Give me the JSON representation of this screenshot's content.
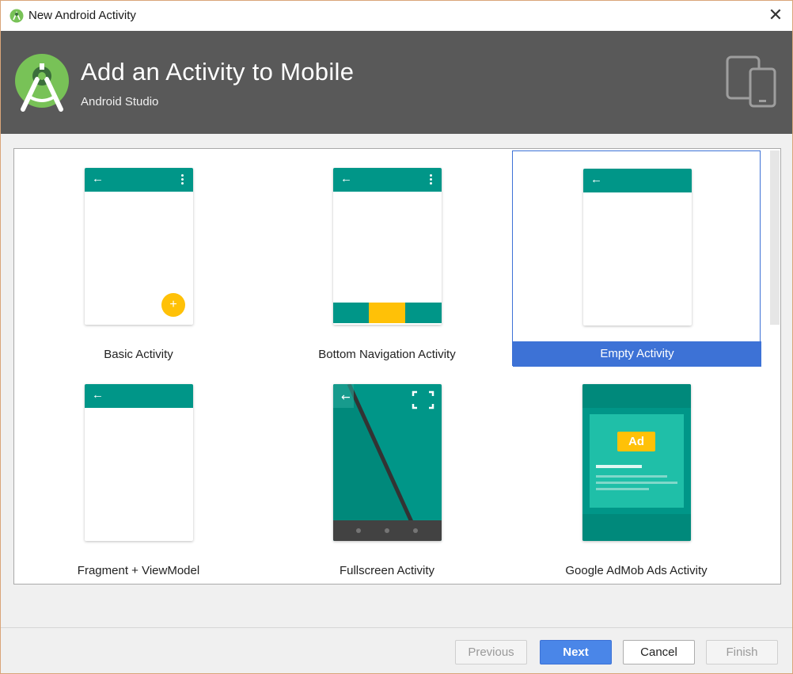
{
  "window": {
    "title": "New Android Activity",
    "close_glyph": "✕"
  },
  "header": {
    "title": "Add an Activity to Mobile",
    "subtitle": "Android Studio"
  },
  "gallery": {
    "selected": "Empty Activity",
    "tiles": [
      {
        "label": "Basic Activity",
        "preview": "basic"
      },
      {
        "label": "Bottom Navigation Activity",
        "preview": "bottom-navigation"
      },
      {
        "label": "Empty Activity",
        "preview": "empty"
      },
      {
        "label": "Fragment + ViewModel",
        "preview": "fragment-viewmodel"
      },
      {
        "label": "Fullscreen Activity",
        "preview": "fullscreen"
      },
      {
        "label": "Google AdMob Ads Activity",
        "preview": "admob"
      }
    ],
    "ad_badge": "Ad",
    "back_glyph": "←",
    "fab_glyph": "+"
  },
  "buttons": {
    "previous": "Previous",
    "next": "Next",
    "cancel": "Cancel",
    "finish": "Finish"
  },
  "colors": {
    "header_bg": "#595959",
    "teal": "#009688",
    "amber": "#ffc107",
    "selection": "#3d72d6",
    "android_green": "#78c257"
  }
}
